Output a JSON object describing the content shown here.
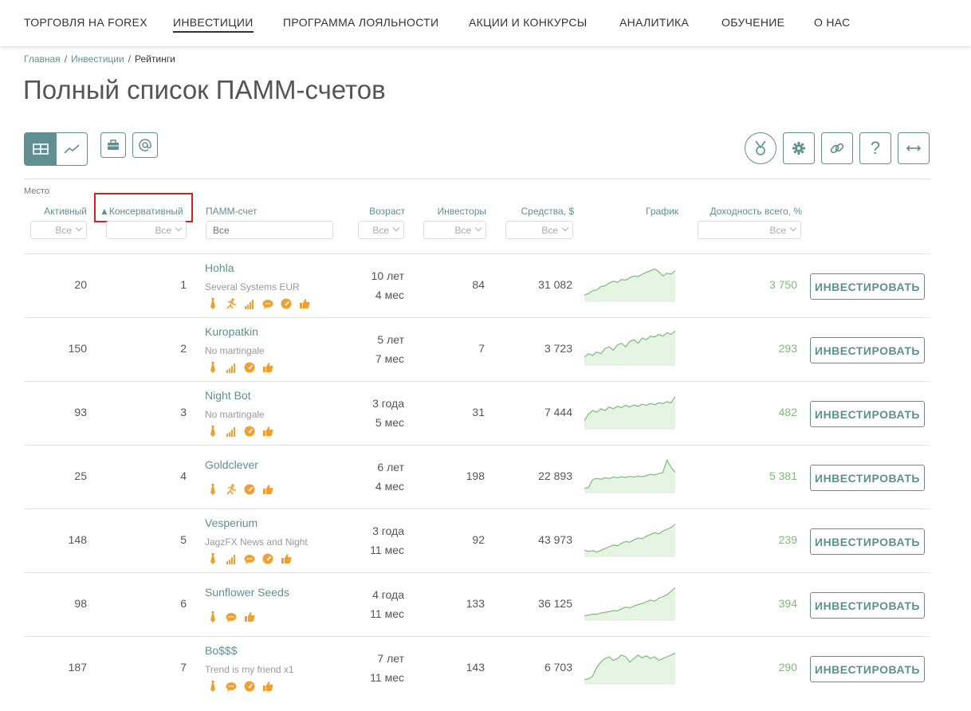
{
  "nav": [
    {
      "label": "ТОРГОВЛЯ НА FOREX",
      "active": false
    },
    {
      "label": "ИНВЕСТИЦИИ",
      "active": true
    },
    {
      "label": "ПРОГРАММА ЛОЯЛЬНОСТИ",
      "active": false
    },
    {
      "label": "АКЦИИ И КОНКУРСЫ",
      "active": false
    },
    {
      "label": "АНАЛИТИКА",
      "active": false
    },
    {
      "label": "ОБУЧЕНИЕ",
      "active": false
    },
    {
      "label": "О НАС",
      "active": false
    }
  ],
  "breadcrumb": {
    "home": "Главная",
    "section": "Инвестиции",
    "current": "Рейтинги"
  },
  "title": "Полный список ПАММ-счетов",
  "toolbar": {
    "left": [
      "table-view-icon",
      "chart-view-icon",
      "briefcase-icon",
      "at-icon"
    ],
    "right": [
      "medal-icon",
      "gear-icon",
      "link-icon",
      "question-icon",
      "expand-horizontal-icon"
    ],
    "question_mark": "?"
  },
  "header": {
    "group_label": "Место",
    "active": "Активный",
    "conservative": "▲Консервативный",
    "account": "ПАММ-счет",
    "age": "Возраст",
    "investors": "Инвесторы",
    "funds": "Средства, $",
    "chart": "График",
    "yield": "Доходность всего, %",
    "filter_all": "Все",
    "filter_placeholder": "Все"
  },
  "colors": {
    "accent": "#5f8f90",
    "positive": "#7cbc75",
    "icon": "#f0a030",
    "highlight": "#cc2222"
  },
  "invest_label": "ИНВЕСТИРОВАТЬ",
  "rows": [
    {
      "active": "20",
      "conservative": "1",
      "name": "Hohla",
      "strategy": "Several Systems EUR",
      "icons": [
        "tie-icon",
        "runner-icon",
        "signal-bars-icon",
        "chat-icon",
        "gauge-icon",
        "thumbs-up-icon"
      ],
      "age_years": "10 лет",
      "age_months": "4 мес",
      "investors": "84",
      "funds": "31 082",
      "yield": "3 750",
      "spark": [
        0.15,
        0.2,
        0.28,
        0.3,
        0.4,
        0.42,
        0.5,
        0.55,
        0.52,
        0.6,
        0.58,
        0.65,
        0.7,
        0.68,
        0.75,
        0.8,
        0.85,
        0.9,
        0.82,
        0.7,
        0.78,
        0.75,
        0.85
      ]
    },
    {
      "active": "150",
      "conservative": "2",
      "name": "Kuropatkin",
      "strategy": "No martingale",
      "icons": [
        "tie-icon",
        "signal-bars-icon",
        "gauge-icon",
        "thumbs-up-icon"
      ],
      "age_years": "5 лет",
      "age_months": "7 мес",
      "investors": "7",
      "funds": "3 723",
      "yield": "293",
      "spark": [
        0.2,
        0.3,
        0.25,
        0.35,
        0.3,
        0.45,
        0.5,
        0.4,
        0.55,
        0.6,
        0.5,
        0.65,
        0.7,
        0.6,
        0.75,
        0.7,
        0.8,
        0.78,
        0.85,
        0.8,
        0.9,
        0.85,
        0.95
      ]
    },
    {
      "active": "93",
      "conservative": "3",
      "name": "Night Bot",
      "strategy": "No martingale",
      "icons": [
        "tie-icon",
        "signal-bars-icon",
        "gauge-icon",
        "thumbs-up-icon"
      ],
      "age_years": "3 года",
      "age_months": "5 мес",
      "investors": "31",
      "funds": "7 444",
      "yield": "482",
      "spark": [
        0.2,
        0.4,
        0.5,
        0.45,
        0.55,
        0.5,
        0.6,
        0.55,
        0.62,
        0.58,
        0.65,
        0.6,
        0.66,
        0.62,
        0.68,
        0.65,
        0.7,
        0.66,
        0.72,
        0.7,
        0.75,
        0.72,
        0.9
      ]
    },
    {
      "active": "25",
      "conservative": "4",
      "name": "Goldclever",
      "strategy": "",
      "icons": [
        "tie-icon",
        "runner-icon",
        "gauge-icon",
        "thumbs-up-icon"
      ],
      "age_years": "6 лет",
      "age_months": "4 мес",
      "investors": "198",
      "funds": "22 893",
      "yield": "5 381",
      "spark": [
        0.1,
        0.12,
        0.35,
        0.38,
        0.36,
        0.4,
        0.38,
        0.42,
        0.4,
        0.43,
        0.41,
        0.44,
        0.42,
        0.45,
        0.43,
        0.46,
        0.5,
        0.48,
        0.52,
        0.55,
        0.9,
        0.7,
        0.55
      ]
    },
    {
      "active": "148",
      "conservative": "5",
      "name": "Vesperium",
      "strategy": "JagzFX News and Night",
      "icons": [
        "tie-icon",
        "signal-bars-icon",
        "chat-icon",
        "gauge-icon",
        "thumbs-up-icon"
      ],
      "age_years": "3 года",
      "age_months": "11 мес",
      "investors": "92",
      "funds": "43 973",
      "yield": "239",
      "spark": [
        0.15,
        0.12,
        0.14,
        0.1,
        0.15,
        0.2,
        0.25,
        0.3,
        0.28,
        0.35,
        0.4,
        0.38,
        0.45,
        0.5,
        0.48,
        0.55,
        0.6,
        0.65,
        0.62,
        0.7,
        0.75,
        0.8,
        0.9
      ]
    },
    {
      "active": "98",
      "conservative": "6",
      "name": "Sunflower Seeds",
      "strategy": "",
      "icons": [
        "tie-icon",
        "chat-icon",
        "thumbs-up-icon"
      ],
      "age_years": "4 года",
      "age_months": "11 мес",
      "investors": "133",
      "funds": "36 125",
      "yield": "394",
      "spark": [
        0.1,
        0.12,
        0.15,
        0.14,
        0.18,
        0.2,
        0.22,
        0.25,
        0.24,
        0.3,
        0.35,
        0.32,
        0.38,
        0.42,
        0.45,
        0.5,
        0.55,
        0.52,
        0.6,
        0.65,
        0.7,
        0.8,
        0.9
      ]
    },
    {
      "active": "187",
      "conservative": "7",
      "name": "Bo$$$",
      "strategy": "Trend is my friend x1",
      "icons": [
        "tie-icon",
        "chat-icon",
        "gauge-icon",
        "thumbs-up-icon"
      ],
      "age_years": "7 лет",
      "age_months": "11 мес",
      "investors": "143",
      "funds": "6 703",
      "yield": "290",
      "spark": [
        0.1,
        0.12,
        0.2,
        0.45,
        0.6,
        0.7,
        0.75,
        0.65,
        0.7,
        0.8,
        0.75,
        0.6,
        0.7,
        0.8,
        0.72,
        0.78,
        0.7,
        0.75,
        0.65,
        0.7,
        0.75,
        0.8,
        0.85
      ]
    }
  ]
}
